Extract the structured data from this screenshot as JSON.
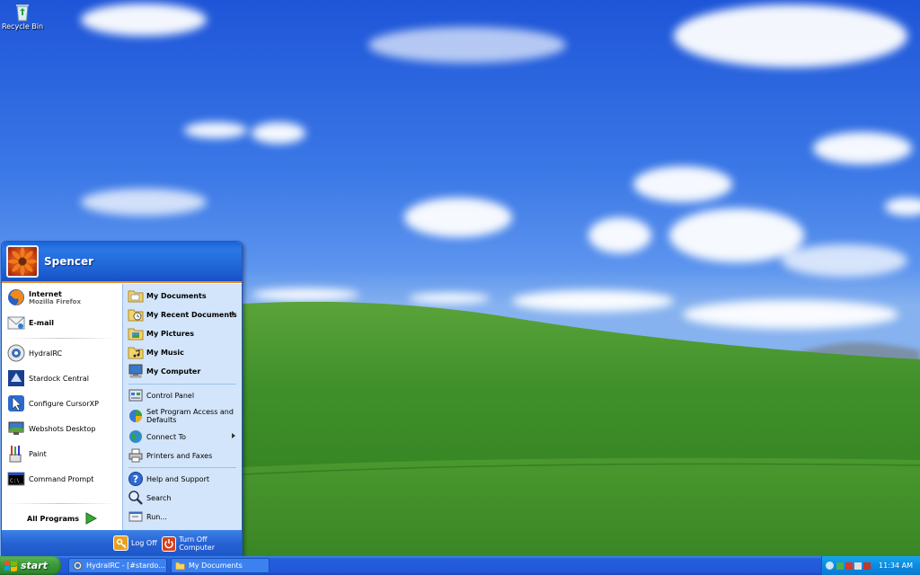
{
  "desktop": {
    "icons": [
      {
        "label": "Recycle Bin",
        "icon": "recycle-bin-icon"
      }
    ]
  },
  "start_menu": {
    "user_name": "Spencer",
    "pinned": [
      {
        "label": "Internet",
        "sub": "Mozilla Firefox",
        "icon": "firefox-icon"
      },
      {
        "label": "E-mail",
        "icon": "email-icon"
      }
    ],
    "recent": [
      {
        "label": "HydraIRC",
        "icon": "hydrairc-icon"
      },
      {
        "label": "Stardock Central",
        "icon": "stardock-icon"
      },
      {
        "label": "Configure CursorXP",
        "icon": "cursorxp-icon"
      },
      {
        "label": "Webshots Desktop",
        "icon": "webshots-icon"
      },
      {
        "label": "Paint",
        "icon": "paint-icon"
      },
      {
        "label": "Command Prompt",
        "icon": "command-prompt-icon"
      }
    ],
    "all_programs": "All Programs",
    "places": [
      {
        "label": "My Documents",
        "icon": "folder-icon"
      },
      {
        "label": "My Recent Documents",
        "icon": "recent-documents-icon"
      },
      {
        "label": "My Pictures",
        "icon": "pictures-folder-icon"
      },
      {
        "label": "My Music",
        "icon": "music-folder-icon"
      },
      {
        "label": "My Computer",
        "icon": "computer-icon"
      }
    ],
    "system": [
      {
        "label": "Control Panel",
        "icon": "control-panel-icon"
      },
      {
        "label": "Set Program Access and Defaults",
        "icon": "program-access-icon"
      },
      {
        "label": "Connect To",
        "icon": "connect-icon"
      },
      {
        "label": "Printers and Faxes",
        "icon": "printer-icon"
      }
    ],
    "help": [
      {
        "label": "Help and Support",
        "icon": "help-icon"
      },
      {
        "label": "Search",
        "icon": "search-icon"
      },
      {
        "label": "Run...",
        "icon": "run-icon"
      }
    ],
    "log_off": "Log Off",
    "turn_off": "Turn Off Computer"
  },
  "taskbar": {
    "start_label": "start",
    "tasks": [
      {
        "label": "HydraIRC - [#stardo...",
        "icon": "hydrairc-icon"
      },
      {
        "label": "My Documents",
        "icon": "folder-icon"
      }
    ],
    "clock": "11:34 AM"
  },
  "colors": {
    "start_green": "#3e9c3e",
    "taskbar_blue": "#245edb",
    "menu_header_blue": "#1f63d6",
    "menu_right_pane": "#d3e5fa",
    "tray_blue": "#0c8ae0"
  }
}
